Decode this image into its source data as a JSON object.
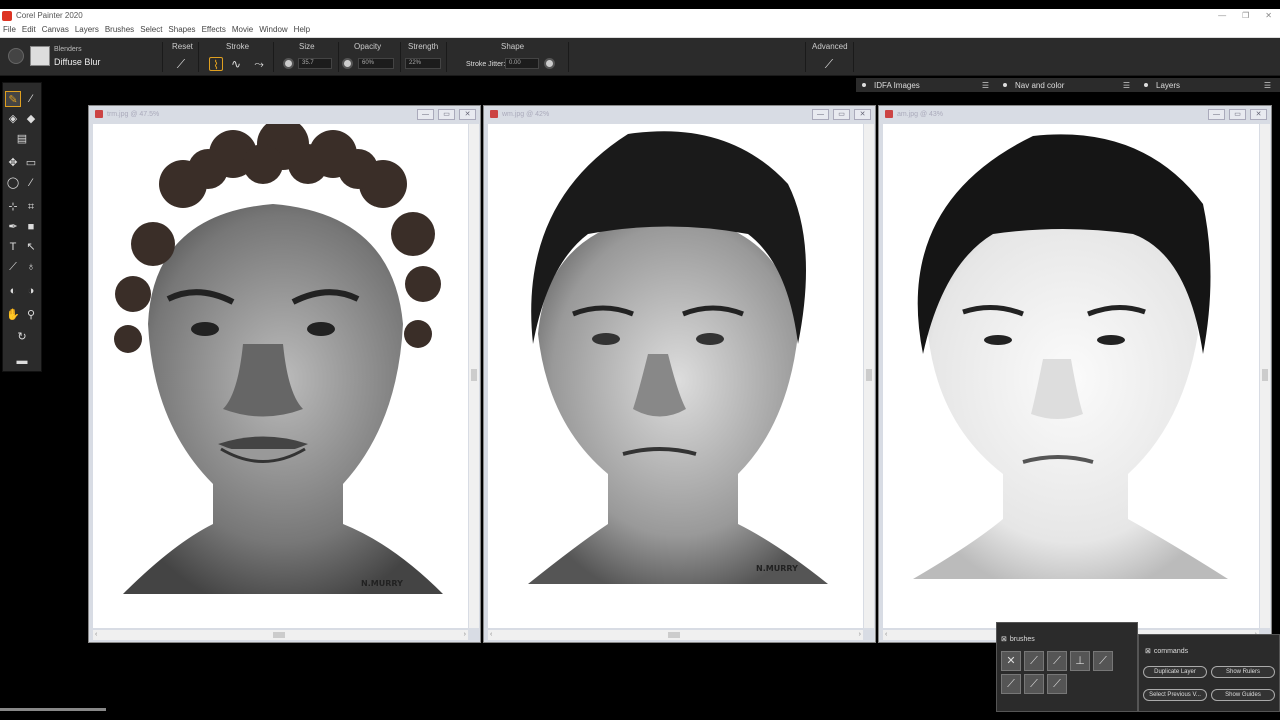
{
  "app": {
    "title": "Corel Painter 2020"
  },
  "menu": [
    "File",
    "Edit",
    "Canvas",
    "Layers",
    "Brushes",
    "Select",
    "Shapes",
    "Effects",
    "Movie",
    "Window",
    "Help"
  ],
  "propbar": {
    "category": "Blenders",
    "variant": "Diffuse Blur",
    "labels": {
      "reset": "Reset",
      "stroke": "Stroke",
      "size": "Size",
      "opacity": "Opacity",
      "strength": "Strength",
      "shape": "Shape",
      "advanced": "Advanced"
    },
    "size_value": "35.7",
    "opacity_value": "60%",
    "strength_value": "22%",
    "stroke_jitter_label": "Stroke Jitter:",
    "stroke_jitter_value": "0.00"
  },
  "panel_tabs": [
    "IDFA Images",
    "Nav and color",
    "Layers"
  ],
  "documents": [
    {
      "title": "trm.jpg @ 47.5%",
      "signature": "N.MURRY"
    },
    {
      "title": "wm.jpg @ 42%",
      "signature": "N.MURRY"
    },
    {
      "title": "am.jpg @ 43%",
      "signature": ""
    }
  ],
  "brushes_panel": {
    "title": "brushes"
  },
  "commands_panel": {
    "title": "commands",
    "buttons": [
      "Duplicate Layer",
      "Show Rulers",
      "Select Previous V...",
      "Show Guides"
    ]
  }
}
